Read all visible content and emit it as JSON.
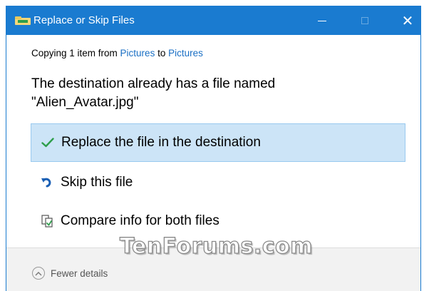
{
  "window": {
    "title": "Replace or Skip Files",
    "accent_color": "#1a7bd0",
    "controls": {
      "minimize_icon": "minimize-icon",
      "maximize_icon": "maximize-icon",
      "close_icon": "close-icon"
    }
  },
  "copying": {
    "prefix": "Copying 1 item from ",
    "source": "Pictures",
    "middle": " to ",
    "destination": "Pictures"
  },
  "message": {
    "line1": "The destination already has a file named",
    "line2": "\"Alien_Avatar.jpg\""
  },
  "options": [
    {
      "label": "Replace the file in the destination",
      "icon": "checkmark-icon",
      "selected": true
    },
    {
      "label": "Skip this file",
      "icon": "skip-arrow-icon",
      "selected": false
    },
    {
      "label": "Compare info for both files",
      "icon": "compare-files-icon",
      "selected": false
    }
  ],
  "footer": {
    "toggle_label": "Fewer details",
    "toggle_icon": "chevron-up-icon"
  },
  "watermark": "TenForums.com"
}
